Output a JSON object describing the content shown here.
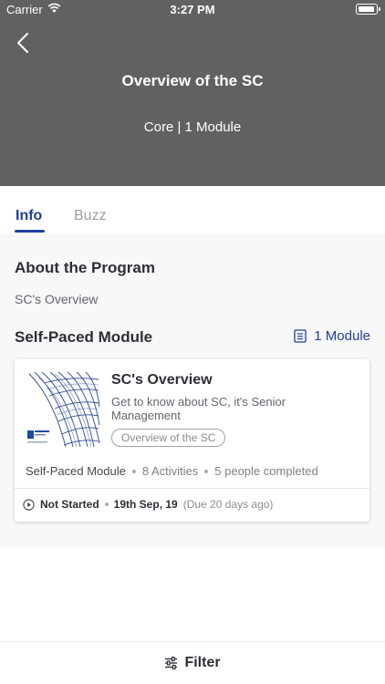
{
  "status_bar": {
    "carrier": "Carrier",
    "time": "3:27 PM"
  },
  "header": {
    "title": "Overview of the SC",
    "subtitle": "Core | 1 Module",
    "background": "#616161"
  },
  "tabs": [
    {
      "label": "Info",
      "active": true
    },
    {
      "label": "Buzz",
      "active": false
    }
  ],
  "about": {
    "heading": "About the Program",
    "text": "SC's Overview"
  },
  "modules": {
    "heading": "Self-Paced Module",
    "link_label": "1 Module",
    "icon": "list-document-icon",
    "card": {
      "title": "SC's Overview",
      "description": "Get to know about SC, it's Senior Management",
      "tag": "Overview of the SC",
      "type": "Self-Paced Module",
      "activities": "8 Activities",
      "completed": "5 people completed",
      "status": "Not Started",
      "date": "19th Sep, 19",
      "due": "(Due 20 days ago)"
    }
  },
  "footer": {
    "filter_label": "Filter",
    "icon": "sliders-icon"
  },
  "colors": {
    "accent": "#1f3f9e",
    "header": "#616161"
  }
}
